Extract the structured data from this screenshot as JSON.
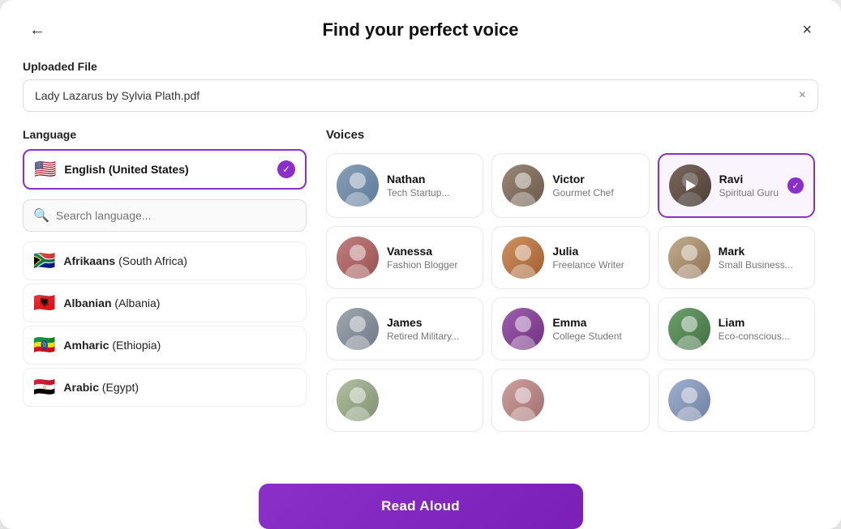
{
  "modal": {
    "title": "Find your perfect voice",
    "back_label": "←",
    "close_label": "×"
  },
  "file_section": {
    "label": "Uploaded File",
    "file_name": "Lady Lazarus by Sylvia Plath.pdf",
    "clear_label": "×"
  },
  "language_section": {
    "label": "Language",
    "selected": {
      "flag": "🇺🇸",
      "name": "English",
      "region": "(United States)"
    },
    "search_placeholder": "Search language...",
    "languages": [
      {
        "flag": "🇿🇦",
        "name": "Afrikaans",
        "region": "(South Africa)"
      },
      {
        "flag": "🇦🇱",
        "name": "Albanian",
        "region": "(Albania)"
      },
      {
        "flag": "🇪🇹",
        "name": "Amharic",
        "region": "(Ethiopia)"
      },
      {
        "flag": "🇪🇬",
        "name": "Arabic",
        "region": "(Egypt)"
      }
    ]
  },
  "voices_section": {
    "label": "Voices",
    "voices": [
      {
        "id": "nathan",
        "name": "Nathan",
        "role": "Tech Startup...",
        "avatar_class": "av-nathan",
        "selected": false,
        "playing": false
      },
      {
        "id": "victor",
        "name": "Victor",
        "role": "Gourmet Chef",
        "avatar_class": "av-victor",
        "selected": false,
        "playing": false
      },
      {
        "id": "ravi",
        "name": "Ravi",
        "role": "Spiritual Guru",
        "avatar_class": "av-ravi",
        "selected": true,
        "playing": true
      },
      {
        "id": "vanessa",
        "name": "Vanessa",
        "role": "Fashion Blogger",
        "avatar_class": "av-vanessa",
        "selected": false,
        "playing": false
      },
      {
        "id": "julia",
        "name": "Julia",
        "role": "Freelance Writer",
        "avatar_class": "av-julia",
        "selected": false,
        "playing": false
      },
      {
        "id": "mark",
        "name": "Mark",
        "role": "Small Business...",
        "avatar_class": "av-mark",
        "selected": false,
        "playing": false
      },
      {
        "id": "james",
        "name": "James",
        "role": "Retired Military...",
        "avatar_class": "av-james",
        "selected": false,
        "playing": false
      },
      {
        "id": "emma",
        "name": "Emma",
        "role": "College Student",
        "avatar_class": "av-emma",
        "selected": false,
        "playing": false
      },
      {
        "id": "liam",
        "name": "Liam",
        "role": "Eco-conscious...",
        "avatar_class": "av-liam",
        "selected": false,
        "playing": false
      },
      {
        "id": "extra1",
        "name": "",
        "role": "",
        "avatar_class": "av-extra1",
        "selected": false,
        "playing": false
      },
      {
        "id": "extra2",
        "name": "",
        "role": "",
        "avatar_class": "av-extra2",
        "selected": false,
        "playing": false
      },
      {
        "id": "extra3",
        "name": "",
        "role": "",
        "avatar_class": "av-extra3",
        "selected": false,
        "playing": false
      }
    ]
  },
  "read_aloud_btn": "Read Aloud"
}
